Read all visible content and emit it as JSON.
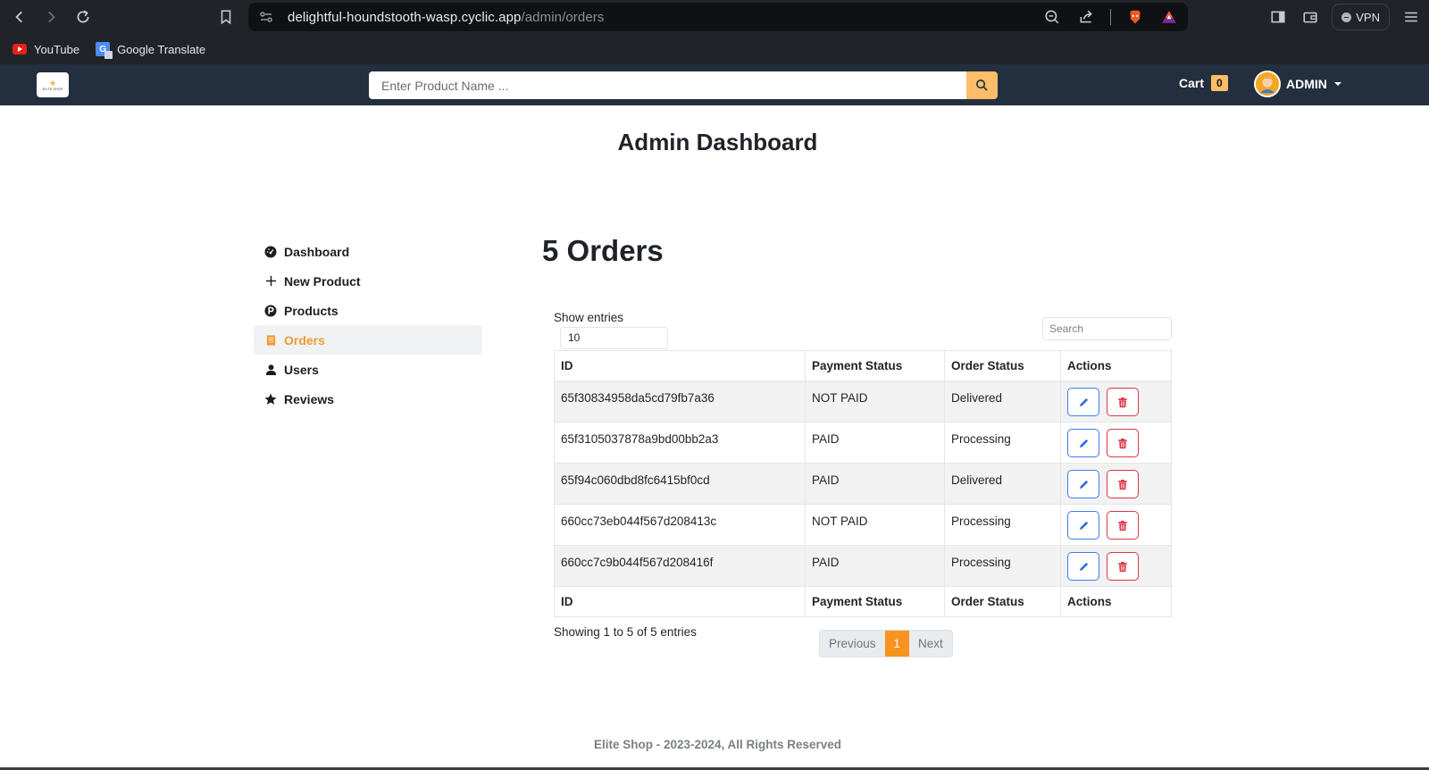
{
  "browser": {
    "url_host": "delightful-houndstooth-wasp.cyclic.app",
    "url_path": "/admin/orders",
    "vpn_label": "VPN",
    "bookmarks": [
      {
        "label": "YouTube",
        "icon": "youtube-icon"
      },
      {
        "label": "Google Translate",
        "icon": "google-translate-icon"
      }
    ]
  },
  "navbar": {
    "logo_text": "ELITE SHOP",
    "search_placeholder": "Enter Product Name ...",
    "cart_label": "Cart",
    "cart_count": "0",
    "user_label": "ADMIN",
    "accent_color": "#febd69",
    "bg_color": "#232f3e"
  },
  "page": {
    "title": "Admin Dashboard"
  },
  "sidebar": {
    "items": [
      {
        "label": "Dashboard",
        "icon": "tachometer-icon",
        "active": false
      },
      {
        "label": "New Product",
        "icon": "plus-icon",
        "active": false
      },
      {
        "label": "Products",
        "icon": "product-hunt-icon",
        "active": false
      },
      {
        "label": "Orders",
        "icon": "receipt-icon",
        "active": true
      },
      {
        "label": "Users",
        "icon": "user-icon",
        "active": false
      },
      {
        "label": "Reviews",
        "icon": "star-icon",
        "active": false
      }
    ]
  },
  "orders": {
    "heading": "5 Orders",
    "show_entries_label": "Show entries",
    "entries_value": "10",
    "search_placeholder": "Search",
    "columns": [
      "ID",
      "Payment Status",
      "Order Status",
      "Actions"
    ],
    "rows": [
      {
        "id": "65f30834958da5cd79fb7a36",
        "payment": "NOT PAID",
        "status": "Delivered"
      },
      {
        "id": "65f3105037878a9bd00bb2a3",
        "payment": "PAID",
        "status": "Processing"
      },
      {
        "id": "65f94c060dbd8fc6415bf0cd",
        "payment": "PAID",
        "status": "Delivered"
      },
      {
        "id": "660cc73eb044f567d208413c",
        "payment": "NOT PAID",
        "status": "Processing"
      },
      {
        "id": "660cc7c9b044f567d208416f",
        "payment": "PAID",
        "status": "Processing"
      }
    ],
    "showing_text": "Showing 1 to 5 of 5 entries",
    "pagination": {
      "previous": "Previous",
      "current": "1",
      "next": "Next"
    }
  },
  "footer": {
    "text": "Elite Shop - 2023-2024, All Rights Reserved"
  }
}
